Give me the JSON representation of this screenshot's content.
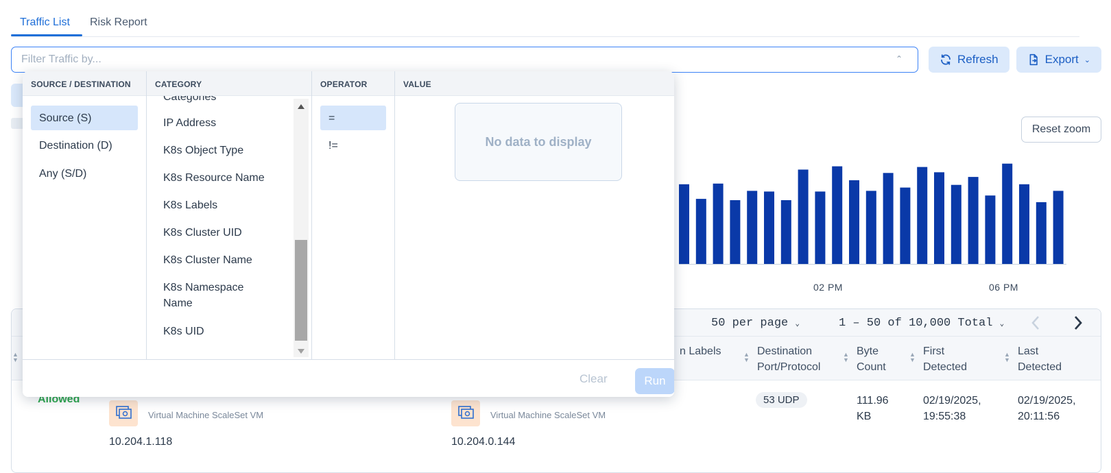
{
  "tabs": [
    {
      "label": "Traffic List",
      "active": true
    },
    {
      "label": "Risk Report",
      "active": false
    }
  ],
  "filter": {
    "placeholder": "Filter Traffic by..."
  },
  "toolbar": {
    "refresh_label": "Refresh",
    "export_label": "Export"
  },
  "chart_area": {
    "reset_zoom_label": "Reset zoom",
    "tick_labels": [
      "02 PM",
      "06 PM"
    ]
  },
  "chart_data": {
    "type": "bar",
    "values": [
      120,
      98,
      121,
      96,
      110,
      109,
      96,
      142,
      109,
      147,
      126,
      110,
      137,
      115,
      146,
      138,
      119,
      131,
      103,
      151,
      120,
      93,
      110
    ],
    "title": "",
    "xlabel": "",
    "ylabel": "",
    "grid": false
  },
  "pager": {
    "per_page": "50 per page",
    "range": "1 – 50 of 10,000 Total"
  },
  "table": {
    "headers": {
      "dest_labels": "n Labels",
      "dest_port": "Destination Port/Protocol",
      "byte_count": "Byte Count",
      "first_detected": "First Detected",
      "last_detected": "Last Detected"
    },
    "row": {
      "status": "Allowed",
      "src_type": "Virtual Machine ScaleSet VM",
      "src_ip": "10.204.1.118",
      "dst_type": "Virtual Machine ScaleSet VM",
      "dst_ip": "10.204.0.144",
      "port": "53 UDP",
      "bytes": "111.96 KB",
      "first": "02/19/2025, 19:55:38",
      "last": "02/19/2025, 20:11:56"
    }
  },
  "dropdown": {
    "headers": {
      "source_dest": "SOURCE / DESTINATION",
      "category": "CATEGORY",
      "operator": "OPERATOR",
      "value": "VALUE"
    },
    "source_dest": [
      "Source (S)",
      "Destination (D)",
      "Any (S/D)"
    ],
    "categories": [
      "Categories",
      "IP Address",
      "K8s Object Type",
      "K8s Resource Name",
      "K8s Labels",
      "K8s Cluster UID",
      "K8s Cluster Name",
      "K8s Namespace Name",
      "K8s UID"
    ],
    "operators": [
      "=",
      "!="
    ],
    "no_data": "No data to display",
    "clear_label": "Clear",
    "run_label": "Run"
  },
  "colors": {
    "accent": "#1f6fd8",
    "bar": "#0a39a8",
    "selected": "#d6e6fb"
  }
}
